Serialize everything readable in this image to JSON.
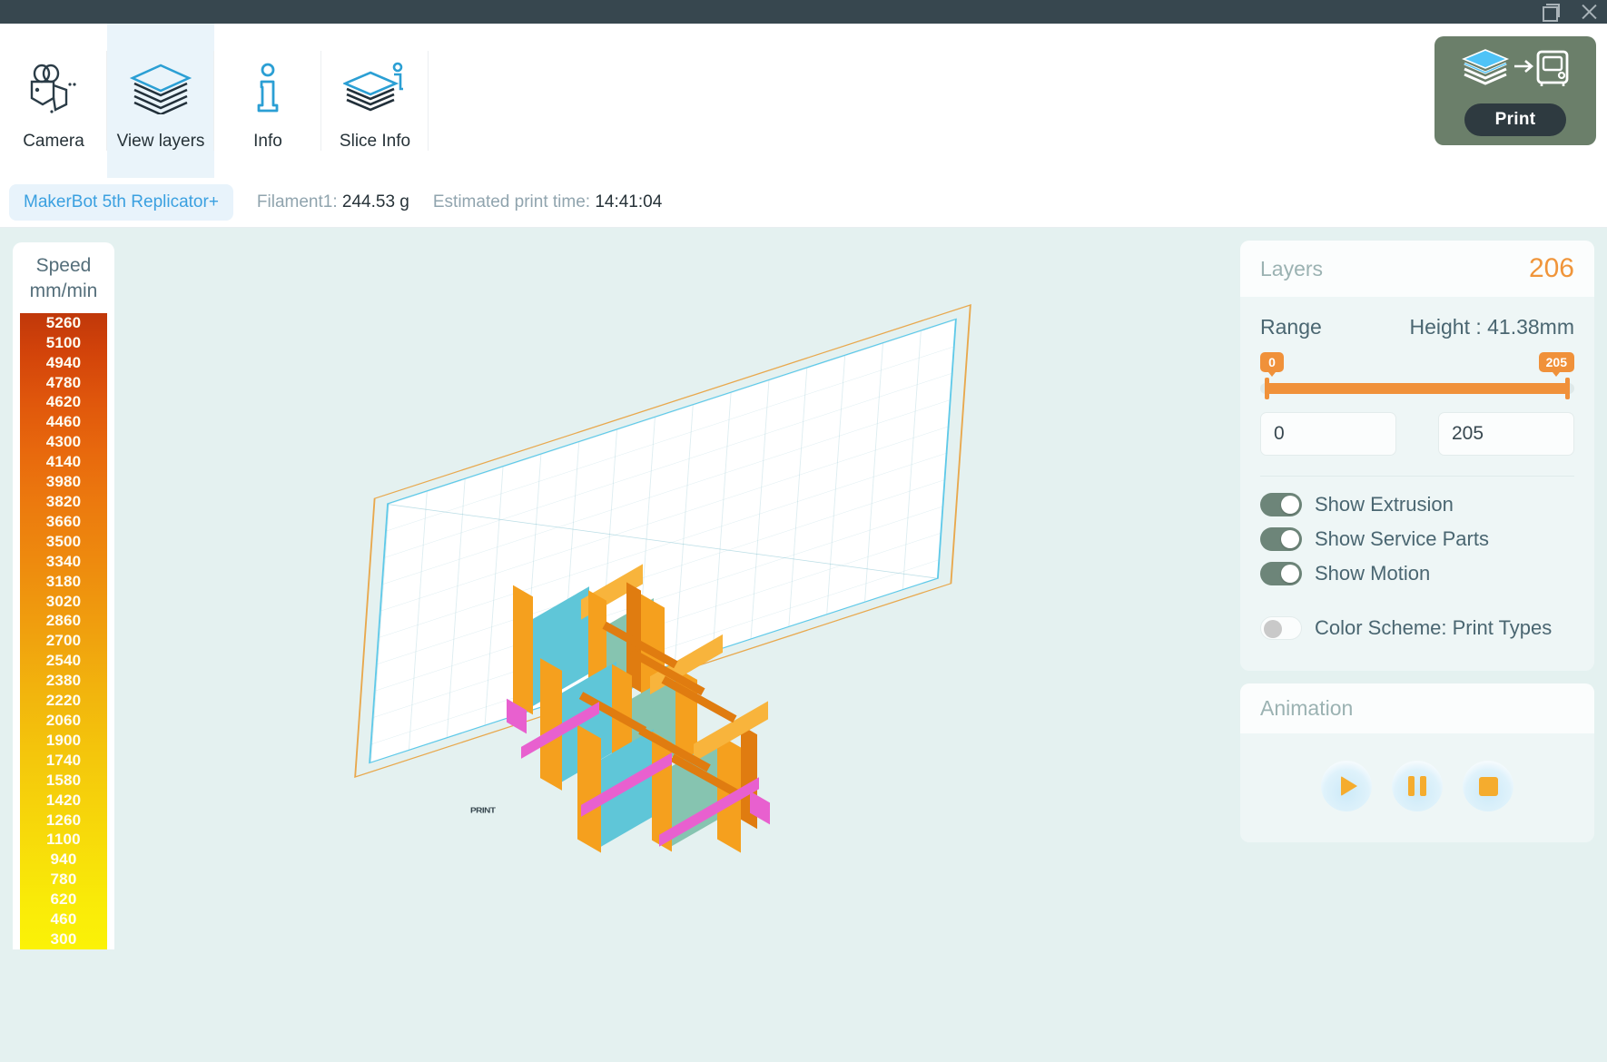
{
  "titlebar": {
    "restore_icon": "restore-window-icon",
    "close_icon": "close-window-icon"
  },
  "toolbar": {
    "tools": [
      {
        "label": "Camera",
        "icon": "camera-icon",
        "active": false
      },
      {
        "label": "View layers",
        "icon": "layers-icon",
        "active": true
      },
      {
        "label": "Info",
        "icon": "info-icon",
        "active": false
      },
      {
        "label": "Slice Info",
        "icon": "slice-info-icon",
        "active": false
      }
    ],
    "print_button": {
      "label": "Print",
      "icon": "layers-to-printer-icon"
    }
  },
  "infobar": {
    "printer": "MakerBot 5th Replicator+",
    "filament_label": "Filament1:",
    "filament_value": "244.53 g",
    "time_label": "Estimated print time:",
    "time_value": "14:41:04"
  },
  "legend": {
    "title_line1": "Speed",
    "title_line2": "mm/min",
    "values": [
      5260,
      5100,
      4940,
      4780,
      4620,
      4460,
      4300,
      4140,
      3980,
      3820,
      3660,
      3500,
      3340,
      3180,
      3020,
      2860,
      2700,
      2540,
      2380,
      2220,
      2060,
      1900,
      1740,
      1580,
      1420,
      1260,
      1100,
      940,
      780,
      620,
      460,
      300
    ],
    "color_top": "#c0380a",
    "color_bottom": "#fbf207"
  },
  "viewport": {
    "plate_tag": "PRINT"
  },
  "layers_card": {
    "title": "Layers",
    "count": "206",
    "range_label": "Range",
    "height_label": "Height : 41.38mm",
    "slider_min_bubble": "0",
    "slider_max_bubble": "205",
    "min_input_value": "0",
    "max_input_value": "205",
    "toggles": [
      {
        "label": "Show Extrusion",
        "state": "on"
      },
      {
        "label": "Show Service Parts",
        "state": "on"
      },
      {
        "label": "Show Motion",
        "state": "on"
      },
      {
        "label": "Color Scheme: Print Types",
        "state": "off"
      }
    ]
  },
  "animation_card": {
    "title": "Animation",
    "buttons": [
      {
        "name": "play-button",
        "icon": "play-icon"
      },
      {
        "name": "pause-button",
        "icon": "pause-icon"
      },
      {
        "name": "stop-button",
        "icon": "stop-icon"
      }
    ]
  },
  "colors": {
    "accent_orange": "#f0913a",
    "accent_blue": "#3aa0e0",
    "print_green": "#6b7f6a"
  }
}
